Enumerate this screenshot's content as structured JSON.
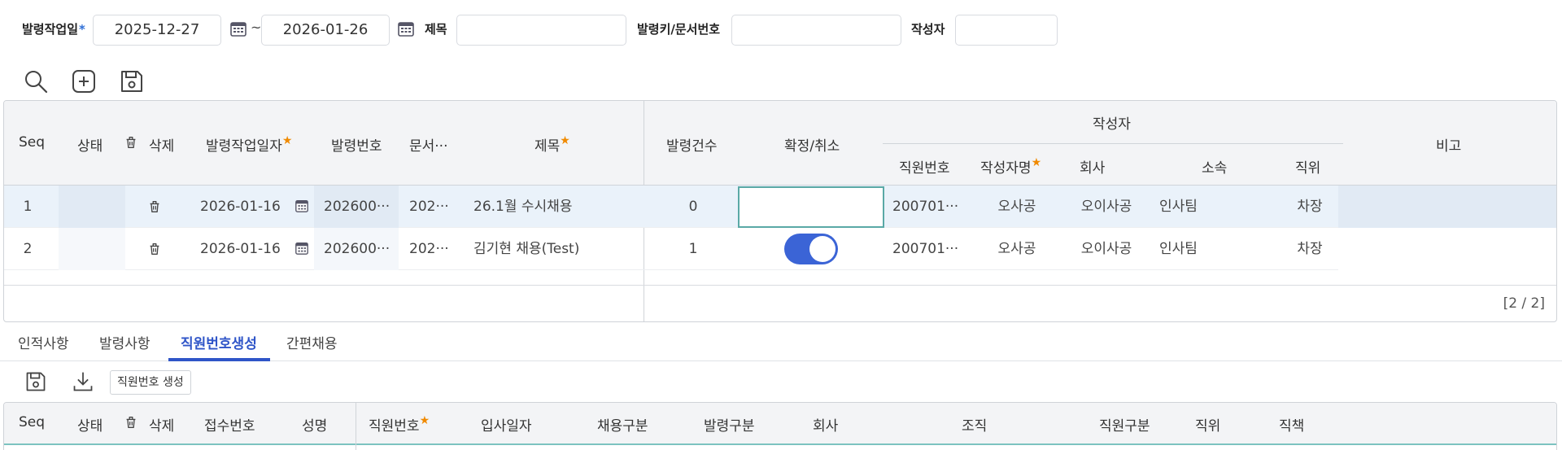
{
  "search": {
    "date_label": "발령작업일",
    "required_mark": "*",
    "date_from": "2025-12-27",
    "tilde": "~",
    "date_to": "2026-01-26",
    "title_label": "제목",
    "title_value": "",
    "key_label": "발령키/문서번호",
    "key_value": "",
    "author_label": "작성자",
    "author_value": ""
  },
  "grid1": {
    "headers": {
      "seq": "Seq",
      "status": "상태",
      "delete": "삭제",
      "work_date": "발령작업일자",
      "appt_no": "발령번호",
      "doc": "문서···",
      "title": "제목",
      "count": "발령건수",
      "confirm": "확정/취소",
      "author_group": "작성자",
      "emp_no": "직원번호",
      "author_name": "작성자명",
      "company": "회사",
      "dept": "소속",
      "position": "직위",
      "remark": "비고"
    },
    "rows": [
      {
        "seq": "1",
        "date": "2026-01-16",
        "appt_no": "202600···",
        "doc": "202···",
        "title": "26.1월 수시채용",
        "count": "0",
        "emp_no": "200701···",
        "name": "오사공",
        "company": "오이사공",
        "dept": "인사팀",
        "position": "차장"
      },
      {
        "seq": "2",
        "date": "2026-01-16",
        "appt_no": "202600···",
        "doc": "202···",
        "title": "김기현 채용(Test)",
        "count": "1",
        "emp_no": "200701···",
        "name": "오사공",
        "company": "오이사공",
        "dept": "인사팀",
        "position": "차장"
      }
    ],
    "page_count": "[2 / 2]"
  },
  "tabs": [
    "인적사항",
    "발령사항",
    "직원번호생성",
    "간편채용"
  ],
  "grid2": {
    "generate_button": "직원번호 생성",
    "headers": {
      "seq": "Seq",
      "status": "상태",
      "delete": "삭제",
      "receipt_no": "접수번호",
      "name": "성명",
      "emp_no": "직원번호",
      "join_date": "입사일자",
      "hire_type": "채용구분",
      "appt_type": "발령구분",
      "company": "회사",
      "org": "조직",
      "emp_type": "직원구분",
      "position": "직위",
      "duty": "직책"
    }
  },
  "colors": {
    "accent": "#2f55c8",
    "toggle_on": "#3b64d6",
    "required_star": "#f08a00",
    "edit_border": "#5aa9a6"
  },
  "icons": [
    "calendar-icon",
    "search-icon",
    "add-icon",
    "save-icon",
    "trash-icon",
    "download-icon"
  ]
}
